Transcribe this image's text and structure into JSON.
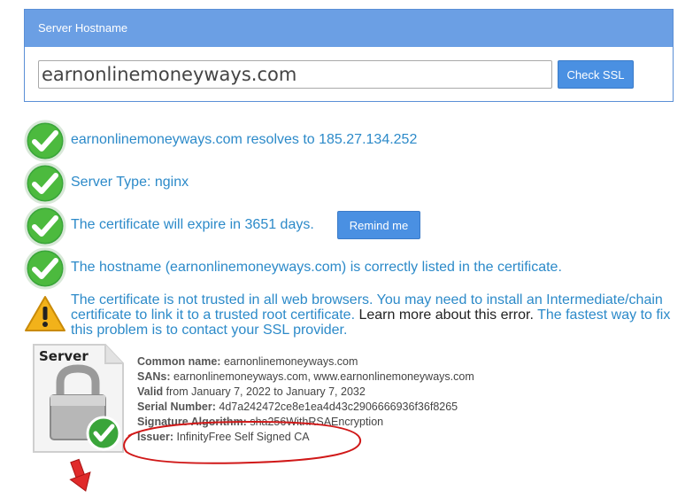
{
  "panel": {
    "header": "Server Hostname"
  },
  "search": {
    "value": "earnonlinemoneyways.com",
    "button": "Check SSL"
  },
  "checks": [
    {
      "icon": "green-check-icon",
      "text": "earnonlinemoneyways.com resolves to 185.27.134.252"
    },
    {
      "icon": "green-check-icon",
      "text": "Server Type: nginx"
    },
    {
      "icon": "green-check-icon",
      "text": "The certificate will expire in 3651 days."
    },
    {
      "icon": "green-check-icon",
      "text": "The hostname (earnonlinemoneyways.com) is correctly listed in the certificate."
    }
  ],
  "remind": "Remind me",
  "warning": {
    "icon": "warning-triangle-icon",
    "text1": "The certificate is not trusted in all web browsers. You may need to install an Intermediate/chain certificate to link it to a trusted root certificate.",
    "link": "Learn more about this error.",
    "text2": "The fastest way to fix this problem is to contact your SSL provider."
  },
  "cert": {
    "icon_label": "Server",
    "common_name_label": "Common name:",
    "common_name": "earnonlinemoneyways.com",
    "sans_label": "SANs:",
    "sans": "earnonlinemoneyways.com, www.earnonlinemoneyways.com",
    "valid_label": "Valid",
    "valid": "from January 7, 2022 to January 7, 2032",
    "serial_label": "Serial Number:",
    "serial": "4d7a242472ce8e1ea4d43c2906666936f36f8265",
    "sig_label": "Signature Algorithm:",
    "sig": "sha256WithRSAEncryption",
    "issuer_label": "Issuer:",
    "issuer": "InfinityFree Self Signed CA"
  },
  "colors": {
    "accent": "#4a90e2",
    "link_text": "#2c8ac9",
    "annotation": "#d01818"
  }
}
